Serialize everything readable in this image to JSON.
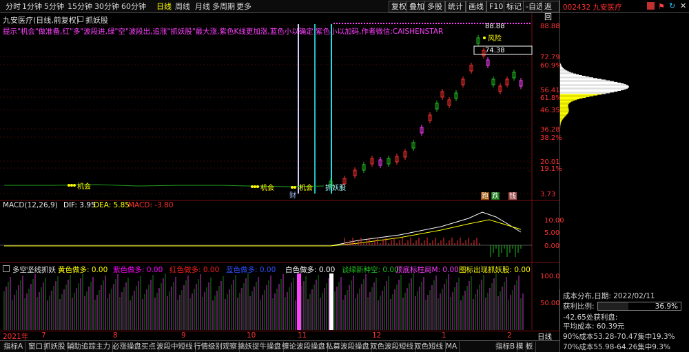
{
  "toolbar": {
    "periods": [
      "分时",
      "1分钟",
      "5分钟",
      "15分钟",
      "30分钟",
      "60分钟",
      "日线",
      "周线",
      "月线",
      "多周期",
      "更多"
    ],
    "active_period": "日线",
    "buttons": [
      "复权",
      "叠加",
      "多股",
      "统计",
      "画线",
      "F10",
      "标记",
      "-自选",
      "返回"
    ]
  },
  "right_header": {
    "stock_label": "002432 九安医疗"
  },
  "title_row": {
    "stock_title": "九安医疗(日线,前复权)",
    "indicator_name": "抓妖股"
  },
  "hint_text": "提示\"机会\"做准备,红\"多\"波段进,绿\"空\"波段出,追涨\"抓妖股\"最大涨,紫色K线更加涨,蓝色小以确定,紫色小以加码,作者微信:CAISHENSTAR",
  "price_axis": {
    "labels": [
      "88.88",
      "72.79",
      "60.9%",
      "56.41",
      "61.8%",
      "46.35",
      "36.28",
      "38.2%",
      "20.01",
      "19.1%",
      "3.73"
    ],
    "colors": [
      "#ff3030",
      "#ff3030",
      "#ff3030",
      "#ff3030",
      "#ff3030",
      "#ff3030",
      "#ff3030",
      "#ff3030",
      "#ff3030",
      "#ff3030",
      "#ff3030"
    ]
  },
  "main_annotations": {
    "high_value": "88.88",
    "risk_label": "风险",
    "mid_value": "74.38",
    "chance_label_1": "机会",
    "chance_label_2": "机会",
    "chance_label_3": "机会",
    "demon_label": "抓妖股",
    "hint_labels": [
      "跑",
      "跌",
      "钱"
    ],
    "cai_label": "财"
  },
  "macd": {
    "title": "MACD(12,26,9)",
    "dif_label": "DIF: 3.95",
    "dea_label": "DEA: 5.85",
    "macd_label": "MACD: -3.80",
    "axis": [
      "10.00",
      "5.00",
      "0.00"
    ]
  },
  "duokong": {
    "title": "多空坚线抓妖",
    "labels": [
      {
        "text": "黄色做多: 0.00",
        "color": "#ffff00"
      },
      {
        "text": "紫色做多: 0.00",
        "color": "#ff00ff"
      },
      {
        "text": "红色做多: 0.00",
        "color": "#ff2020"
      },
      {
        "text": "蓝色做多: 0.00",
        "color": "#3050ff"
      },
      {
        "text": "白色做多: 0.00",
        "color": "#ffffff"
      },
      {
        "text": "谈绿新种空: 0.00",
        "color": "#20c020"
      },
      {
        "text": "顶底标柱局M: 0.00",
        "color": "#ff40ff"
      },
      {
        "text": "图标出现抓妖股: 0.00",
        "color": "#ffff00"
      }
    ],
    "axis": [
      "100.0",
      "50.00"
    ]
  },
  "date_axis": {
    "year_label": "2021年",
    "month_labels": [
      "7",
      "8",
      "9",
      "10",
      "11",
      "12",
      "1",
      "2"
    ],
    "period_button": "日线"
  },
  "bottom_tabs": [
    "指标A",
    "窗口",
    "抓妖股",
    "辅助追踪主力",
    "必涨操盘买点",
    "波段中短线",
    "行情级别观察",
    "擒妖捉牛操盘",
    "缠论波段操盘",
    "私募波段操盘",
    "双色波段短线",
    "双色短线",
    "MA"
  ],
  "bottom_right_tabs": [
    "指标B",
    "模",
    "板"
  ],
  "cost_panel": {
    "title": "成本分布,日期: 2022/02/11",
    "profit_label": "获利比例:",
    "profit_value": "36.9%",
    "profit_fraction": 0.369,
    "profit_ratio_text": "-42.65处获利盘:",
    "avg_cost": "平均成本: 60.39元",
    "c90": "90%成本53.28-70.47集中19.3%",
    "c70": "70%成本55.98-64.26集中9.3%"
  }
}
